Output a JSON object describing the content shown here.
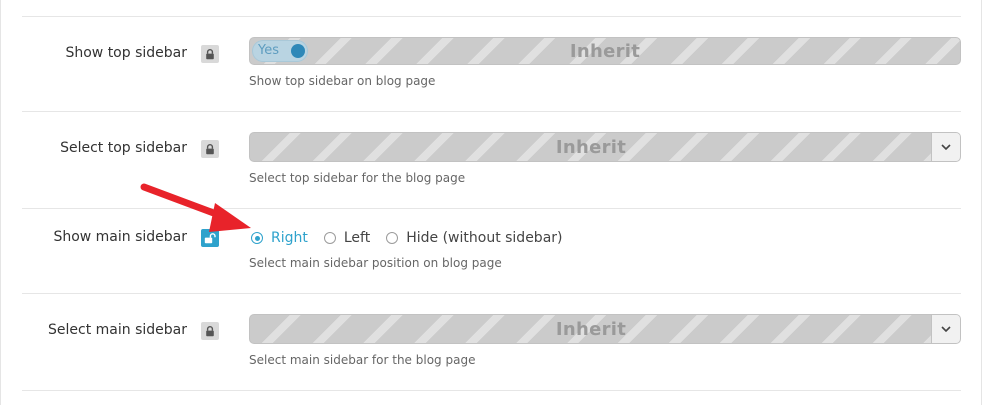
{
  "rows": [
    {
      "label": "Show top sidebar",
      "control": {
        "toggle_label": "Yes",
        "inherit_label": "Inherit"
      },
      "description": "Show top sidebar on blog page"
    },
    {
      "label": "Select top sidebar",
      "control": {
        "inherit_label": "Inherit"
      },
      "description": "Select top sidebar for the blog page"
    },
    {
      "label": "Show main sidebar",
      "control": {
        "options": [
          {
            "label": "Right",
            "selected": true
          },
          {
            "label": "Left",
            "selected": false
          },
          {
            "label": "Hide (without sidebar)",
            "selected": false
          }
        ]
      },
      "description": "Select main sidebar position on blog page"
    },
    {
      "label": "Select main sidebar",
      "control": {
        "inherit_label": "Inherit"
      },
      "description": "Select main sidebar for the blog page"
    }
  ],
  "icons": {
    "lock": "lock-icon",
    "unlock": "unlock-icon",
    "chevron": "chevron-down-icon",
    "arrow": "red-arrow-icon"
  },
  "colors": {
    "accent": "#2ea2cc",
    "arrow": "#e8232a",
    "inherit_text": "#9a9a9a",
    "label_text": "#333333",
    "description_text": "#666666"
  }
}
